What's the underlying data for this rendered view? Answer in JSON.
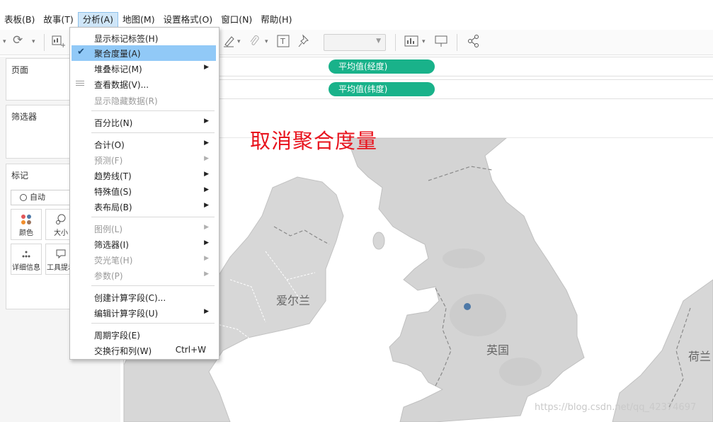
{
  "menubar": {
    "items": [
      {
        "label": "表板(B)"
      },
      {
        "label": "故事(T)"
      },
      {
        "label": "分析(A)"
      },
      {
        "label": "地图(M)"
      },
      {
        "label": "设置格式(O)"
      },
      {
        "label": "窗口(N)"
      },
      {
        "label": "帮助(H)"
      }
    ],
    "active_index": 2
  },
  "shelves": {
    "columns_pill": "平均值(经度)",
    "rows_pill": "平均值(纬度)",
    "pill_color": "#19b28a"
  },
  "left_panel": {
    "pages_title": "页面",
    "filters_title": "筛选器",
    "marks_title": "标记",
    "mark_type": "自动",
    "buttons": {
      "color": "颜色",
      "size": "大小",
      "detail": "详细信息",
      "tooltip": "工具提示"
    }
  },
  "map": {
    "labels": {
      "ireland": "爱尔兰",
      "uk": "英国",
      "netherlands": "荷兰"
    },
    "point_color": "#4e79a7"
  },
  "annotation": "取消聚合度量",
  "watermark": "https://blog.csdn.net/qq_42374697",
  "analysis_menu": {
    "items": [
      {
        "label": "显示标记标签(H)",
        "disabled": false
      },
      {
        "label": "聚合度量(A)",
        "checked": true,
        "highlighted": true
      },
      {
        "label": "堆叠标记(M)",
        "submenu": true
      },
      {
        "label": "查看数据(V)...",
        "icon": "list-icon"
      },
      {
        "label": "显示隐藏数据(R)",
        "disabled": true
      },
      {
        "label": "百分比(N)",
        "submenu": true
      },
      {
        "label": "合计(O)",
        "submenu": true
      },
      {
        "label": "预测(F)",
        "submenu": true,
        "disabled": true
      },
      {
        "label": "趋势线(T)",
        "submenu": true
      },
      {
        "label": "特殊值(S)",
        "submenu": true
      },
      {
        "label": "表布局(B)",
        "submenu": true
      },
      {
        "label": "图例(L)",
        "submenu": true,
        "disabled": true
      },
      {
        "label": "筛选器(I)",
        "submenu": true
      },
      {
        "label": "荧光笔(H)",
        "submenu": true,
        "disabled": true
      },
      {
        "label": "参数(P)",
        "submenu": true,
        "disabled": true
      },
      {
        "label": "创建计算字段(C)..."
      },
      {
        "label": "编辑计算字段(U)",
        "submenu": true
      },
      {
        "label": "周期字段(E)"
      },
      {
        "label": "交换行和列(W)",
        "shortcut": "Ctrl+W"
      }
    ]
  }
}
